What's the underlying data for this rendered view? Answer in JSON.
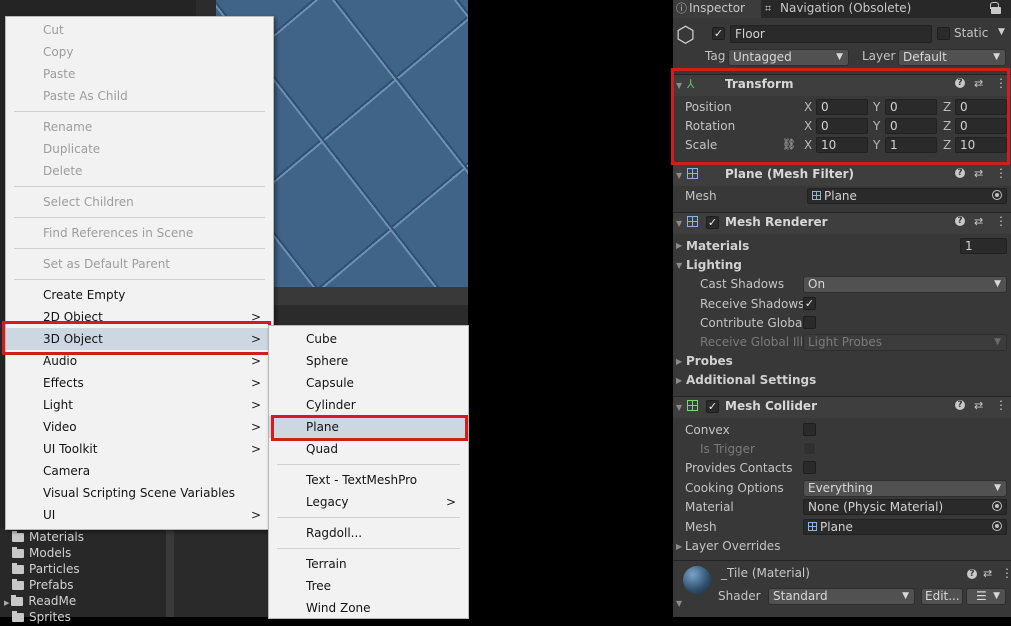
{
  "context_menu": {
    "items": [
      {
        "label": "Cut",
        "enabled": false
      },
      {
        "label": "Copy",
        "enabled": false
      },
      {
        "label": "Paste",
        "enabled": false
      },
      {
        "label": "Paste As Child",
        "enabled": false
      },
      {
        "label": "Rename",
        "enabled": false
      },
      {
        "label": "Duplicate",
        "enabled": false
      },
      {
        "label": "Delete",
        "enabled": false
      },
      {
        "label": "Select Children",
        "enabled": false
      },
      {
        "label": "Find References in Scene",
        "enabled": false
      },
      {
        "label": "Set as Default Parent",
        "enabled": false
      },
      {
        "label": "Create Empty",
        "enabled": true
      },
      {
        "label": "2D Object",
        "enabled": true,
        "submenu": true
      },
      {
        "label": "3D Object",
        "enabled": true,
        "submenu": true,
        "highlighted": true
      },
      {
        "label": "Audio",
        "enabled": true,
        "submenu": true
      },
      {
        "label": "Effects",
        "enabled": true,
        "submenu": true
      },
      {
        "label": "Light",
        "enabled": true,
        "submenu": true
      },
      {
        "label": "Video",
        "enabled": true,
        "submenu": true
      },
      {
        "label": "UI Toolkit",
        "enabled": true,
        "submenu": true
      },
      {
        "label": "Camera",
        "enabled": true
      },
      {
        "label": "Visual Scripting Scene Variables",
        "enabled": true
      },
      {
        "label": "UI",
        "enabled": true,
        "submenu": true
      }
    ],
    "chevron": ">"
  },
  "submenu_3d": {
    "items": [
      {
        "label": "Cube"
      },
      {
        "label": "Sphere"
      },
      {
        "label": "Capsule"
      },
      {
        "label": "Cylinder"
      },
      {
        "label": "Plane",
        "highlighted": true
      },
      {
        "label": "Quad"
      },
      {
        "label": "Text - TextMeshPro"
      },
      {
        "label": "Legacy",
        "submenu": true
      },
      {
        "label": "Ragdoll..."
      },
      {
        "label": "Terrain"
      },
      {
        "label": "Tree"
      },
      {
        "label": "Wind Zone"
      }
    ]
  },
  "project": {
    "folders": [
      "Materials",
      "Models",
      "Particles",
      "Prefabs",
      "ReadMe",
      "Sprites"
    ]
  },
  "inspector": {
    "tabs": [
      "Inspector",
      "Navigation (Obsolete)"
    ],
    "object_name": "Floor",
    "static_label": "Static",
    "tag_label": "Tag",
    "tag_value": "Untagged",
    "layer_label": "Layer",
    "layer_value": "Default",
    "transform": {
      "title": "Transform",
      "position_label": "Position",
      "position": {
        "x": "0",
        "y": "0",
        "z": "0"
      },
      "rotation_label": "Rotation",
      "rotation": {
        "x": "0",
        "y": "0",
        "z": "0"
      },
      "scale_label": "Scale",
      "scale": {
        "x": "10",
        "y": "1",
        "z": "10"
      },
      "axis_x": "X",
      "axis_y": "Y",
      "axis_z": "Z"
    },
    "mesh_filter": {
      "title": "Plane (Mesh Filter)",
      "mesh_label": "Mesh",
      "mesh_value": "Plane"
    },
    "mesh_renderer": {
      "title": "Mesh Renderer",
      "materials_label": "Materials",
      "materials_count": "1",
      "lighting_label": "Lighting",
      "cast_shadows_label": "Cast Shadows",
      "cast_shadows_value": "On",
      "receive_shadows_label": "Receive Shadows",
      "contribute_gi_label": "Contribute Global I",
      "receive_gi_label": "Receive Global Illu",
      "receive_gi_value": "Light Probes",
      "probes_label": "Probes",
      "additional_label": "Additional Settings"
    },
    "mesh_collider": {
      "title": "Mesh Collider",
      "convex_label": "Convex",
      "is_trigger_label": "Is Trigger",
      "provides_contacts_label": "Provides Contacts",
      "cooking_label": "Cooking Options",
      "cooking_value": "Everything",
      "material_label": "Material",
      "material_value": "None (Physic Material)",
      "mesh_label": "Mesh",
      "mesh_value": "Plane",
      "layer_overrides_label": "Layer Overrides"
    },
    "material": {
      "title": "_Tile (Material)",
      "shader_label": "Shader",
      "shader_value": "Standard",
      "edit_label": "Edit..."
    }
  },
  "colors": {
    "highlight_box": "#d21d1d",
    "menu_bg": "#f2f2f2",
    "inspector_bg": "#383838",
    "scene_blue": "#3f6488"
  }
}
